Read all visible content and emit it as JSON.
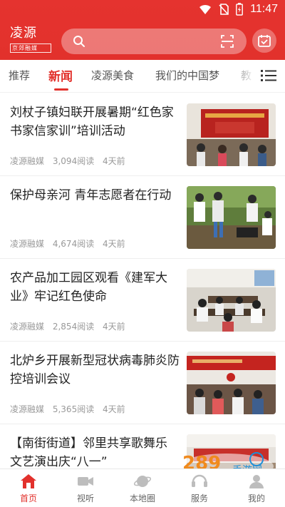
{
  "status": {
    "time": "11:47",
    "icons": [
      "wifi-icon",
      "no-sim-icon",
      "battery-icon"
    ]
  },
  "header": {
    "logo_main": "凌源",
    "logo_sub": "京郊融媒",
    "search_placeholder": "",
    "icons": {
      "search": "search-icon",
      "scan": "scan-icon",
      "calendar": "calendar-check-icon"
    }
  },
  "tabs": [
    {
      "label": "推荐",
      "active": false
    },
    {
      "label": "新闻",
      "active": true
    },
    {
      "label": "凌源美食",
      "active": false
    },
    {
      "label": "我们的中国梦",
      "active": false
    },
    {
      "label": "教",
      "active": false
    }
  ],
  "articles": [
    {
      "title": "刘杖子镇妇联开展暑期“红色家书家信家训”培训活动",
      "source": "凌源融媒",
      "reads": "3,094阅读",
      "time": "4天前"
    },
    {
      "title": "保护母亲河 青年志愿者在行动",
      "source": "凌源融媒",
      "reads": "4,674阅读",
      "time": "4天前"
    },
    {
      "title": "农产品加工园区观看《建军大业》牢记红色使命",
      "source": "凌源融媒",
      "reads": "2,854阅读",
      "time": "4天前"
    },
    {
      "title": "北炉乡开展新型冠状病毒肺炎防控培训会议",
      "source": "凌源融媒",
      "reads": "5,365阅读",
      "time": "4天前"
    },
    {
      "title": "【南街街道】邻里共享歌舞乐 文艺演出庆“八一”",
      "source": "",
      "reads": "",
      "time": ""
    }
  ],
  "bottom_nav": [
    {
      "label": "首页",
      "icon": "home-icon",
      "active": true
    },
    {
      "label": "视听",
      "icon": "video-icon",
      "active": false
    },
    {
      "label": "本地圈",
      "icon": "planet-icon",
      "active": false
    },
    {
      "label": "服务",
      "icon": "service-icon",
      "active": false
    },
    {
      "label": "我的",
      "icon": "user-icon",
      "active": false
    }
  ],
  "watermark": {
    "text": "手游网",
    "number": "289"
  },
  "colors": {
    "brand": "#e2312c",
    "text": "#222222",
    "meta": "#999999"
  }
}
